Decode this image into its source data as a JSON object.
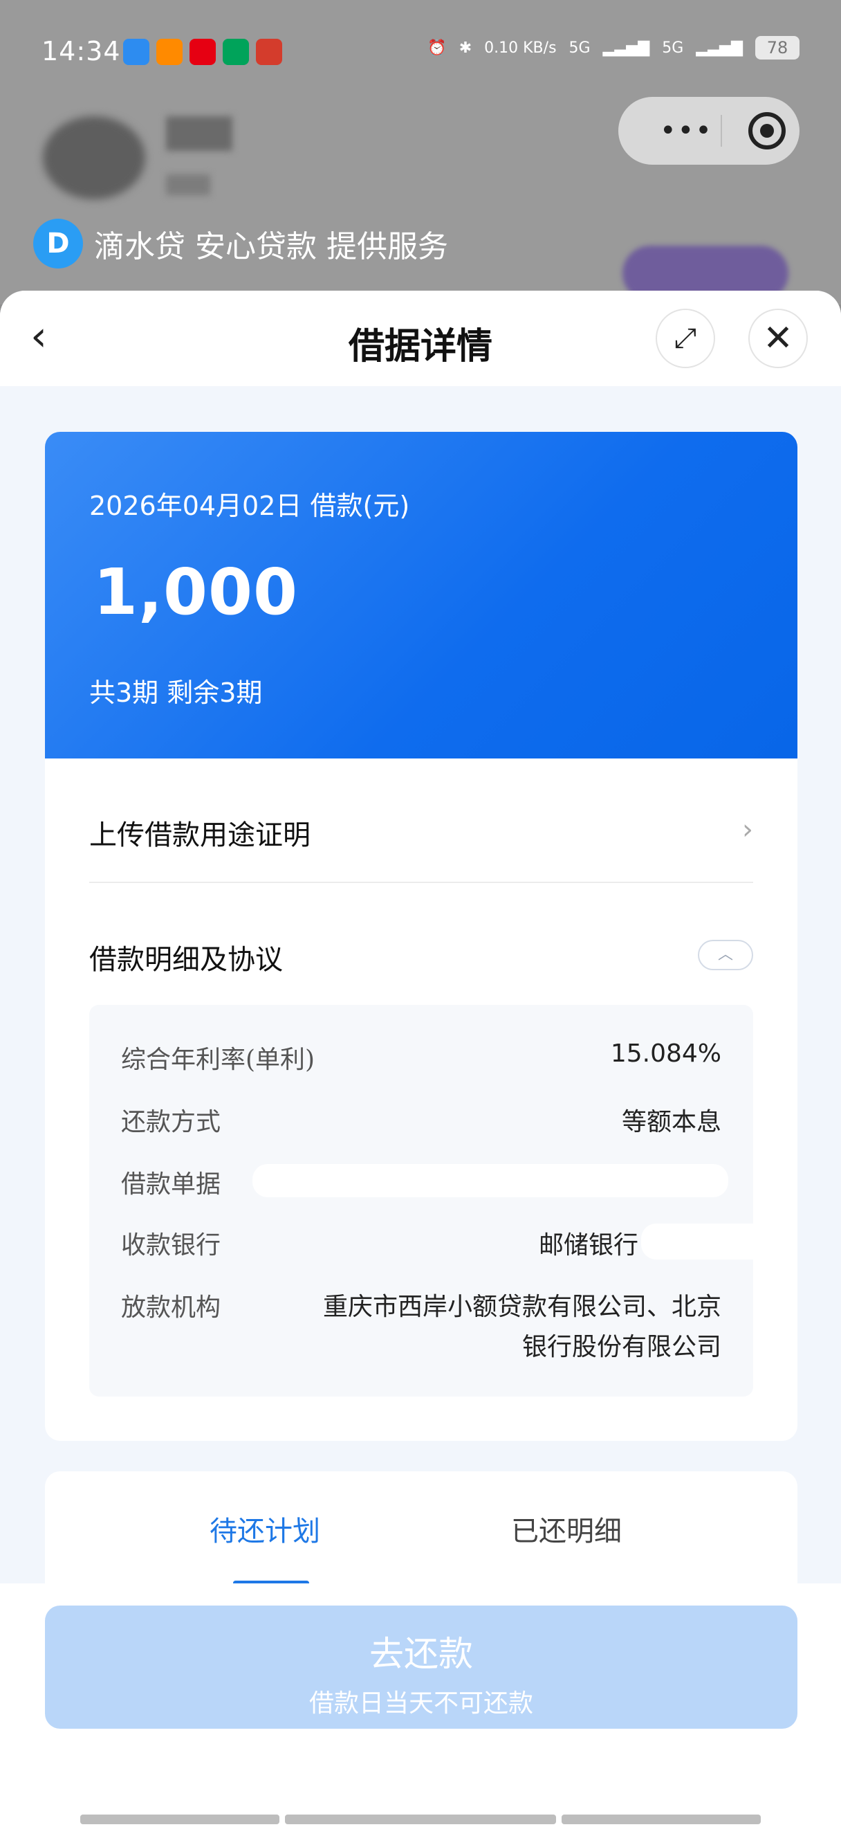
{
  "status_bar": {
    "time": "14:34",
    "net_speed": "0.10 KB/s",
    "signal1": "5G",
    "signal2": "5G",
    "battery": "78",
    "app_icon_colors": [
      "#2d8cf0",
      "#ff8a00",
      "#e60012",
      "#00a35a",
      "#d43c2c"
    ]
  },
  "background": {
    "banner_logo": "D",
    "banner_text": "滴水贷 安心贷款 提供服务"
  },
  "capsule": {
    "more": "•••"
  },
  "nav": {
    "back": "‹",
    "title": "借据详情",
    "expand": "⤢",
    "close": "✕"
  },
  "hero": {
    "date_label": "2026年04月02日 借款(元)",
    "amount": "1,000",
    "periods": "共3期  剩余3期"
  },
  "rows": {
    "upload_label": "上传借款用途证明",
    "upload_chevron": "›",
    "detail_label": "借款明细及协议",
    "collapse_icon": "︿"
  },
  "details": [
    {
      "label": "综合年利率(单利)",
      "value": "15.084%"
    },
    {
      "label": "还款方式",
      "value": "等额本息"
    },
    {
      "label": "借款单据",
      "value": ""
    },
    {
      "label": "收款银行",
      "value": "邮储银行"
    },
    {
      "label": "放款机构",
      "value": "重庆市西岸小额贷款有限公司、北京\n银行股份有限公司"
    }
  ],
  "tabs": {
    "pending": "待还计划",
    "repaid": "已还明细"
  },
  "pay_button": {
    "label": "去还款",
    "note": "借款日当天不可还款"
  },
  "colors": {
    "primary": "#1e78e6",
    "hero_gradient_start": "#3a8cf6",
    "hero_gradient_end": "#0866e8",
    "button_disabled": "#b9d6f9"
  }
}
